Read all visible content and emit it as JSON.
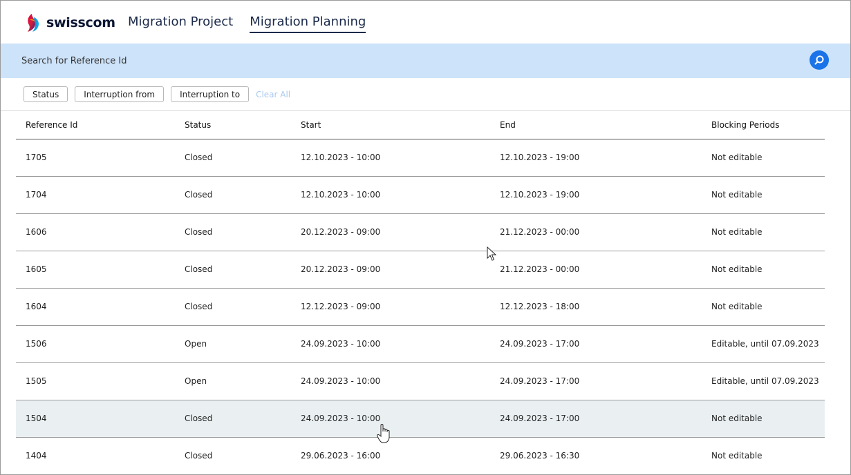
{
  "brand": {
    "name": "swisscom",
    "logo_icon": "swisscom-logo-icon"
  },
  "nav": [
    {
      "label": "Migration Project",
      "active": false
    },
    {
      "label": "Migration Planning",
      "active": true
    }
  ],
  "search": {
    "placeholder": "Search for Reference Id",
    "value": "",
    "button_icon": "search-icon"
  },
  "filters": {
    "chips": [
      "Status",
      "Interruption from",
      "Interruption to"
    ],
    "clear_all": "Clear All"
  },
  "table": {
    "columns": [
      "Reference Id",
      "Status",
      "Start",
      "End",
      "Blocking Periods"
    ],
    "rows": [
      {
        "id": "1705",
        "status": "Closed",
        "start": "12.10.2023 - 10:00",
        "end": "12.10.2023 - 19:00",
        "blocking": "Not editable"
      },
      {
        "id": "1704",
        "status": "Closed",
        "start": "12.10.2023 - 10:00",
        "end": "12.10.2023 - 19:00",
        "blocking": "Not editable"
      },
      {
        "id": "1606",
        "status": "Closed",
        "start": "20.12.2023 - 09:00",
        "end": "21.12.2023 - 00:00",
        "blocking": "Not editable"
      },
      {
        "id": "1605",
        "status": "Closed",
        "start": "20.12.2023 - 09:00",
        "end": "21.12.2023 - 00:00",
        "blocking": "Not editable"
      },
      {
        "id": "1604",
        "status": "Closed",
        "start": "12.12.2023 - 09:00",
        "end": "12.12.2023 - 18:00",
        "blocking": "Not editable"
      },
      {
        "id": "1506",
        "status": "Open",
        "start": "24.09.2023 - 10:00",
        "end": "24.09.2023 - 17:00",
        "blocking": "Editable, until 07.09.2023"
      },
      {
        "id": "1505",
        "status": "Open",
        "start": "24.09.2023 - 10:00",
        "end": "24.09.2023 - 17:00",
        "blocking": "Editable, until 07.09.2023"
      },
      {
        "id": "1504",
        "status": "Closed",
        "start": "24.09.2023 - 10:00",
        "end": "24.09.2023 - 17:00",
        "blocking": "Not editable"
      },
      {
        "id": "1404",
        "status": "Closed",
        "start": "29.06.2023 - 16:00",
        "end": "29.06.2023 - 16:30",
        "blocking": "Not editable"
      }
    ]
  },
  "colors": {
    "search_band": "#cde3fa",
    "search_button": "#1a73e8",
    "status_closed": "#1f8a3a",
    "status_open": "#c61a1a",
    "row_hover": "#eaf0f2"
  }
}
